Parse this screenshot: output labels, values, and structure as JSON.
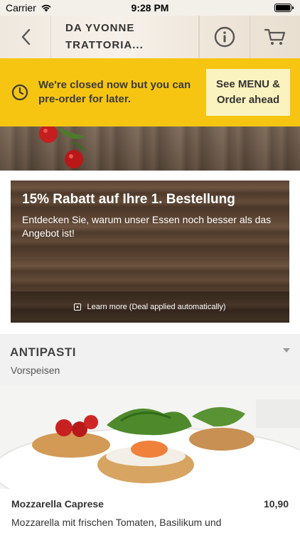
{
  "status_bar": {
    "carrier": "Carrier",
    "time": "9:28 PM"
  },
  "header": {
    "title": "DA YVONNE TRATTORIA...",
    "back_icon": "chevron-left-icon",
    "info_icon": "info-icon",
    "cart_icon": "cart-icon"
  },
  "closed_banner": {
    "message": "We're closed now but you can pre-order for later.",
    "button_label": "See MENU & Order ahead",
    "icon": "clock-icon",
    "bg_color": "#f6c511"
  },
  "promo": {
    "title": "15% Rabatt auf Ihre 1. Bestellung",
    "description": "Entdecken Sie, warum unser Essen noch besser als das Angebot ist!",
    "footer": "Learn more (Deal applied automatically)"
  },
  "category": {
    "title": "ANTIPASTI",
    "subtitle": "Vorspeisen"
  },
  "items": [
    {
      "name": "Mozzarella Caprese",
      "price": "10,90",
      "description": "Mozzarella mit frischen Tomaten, Basilikum und Olivenöl"
    }
  ]
}
